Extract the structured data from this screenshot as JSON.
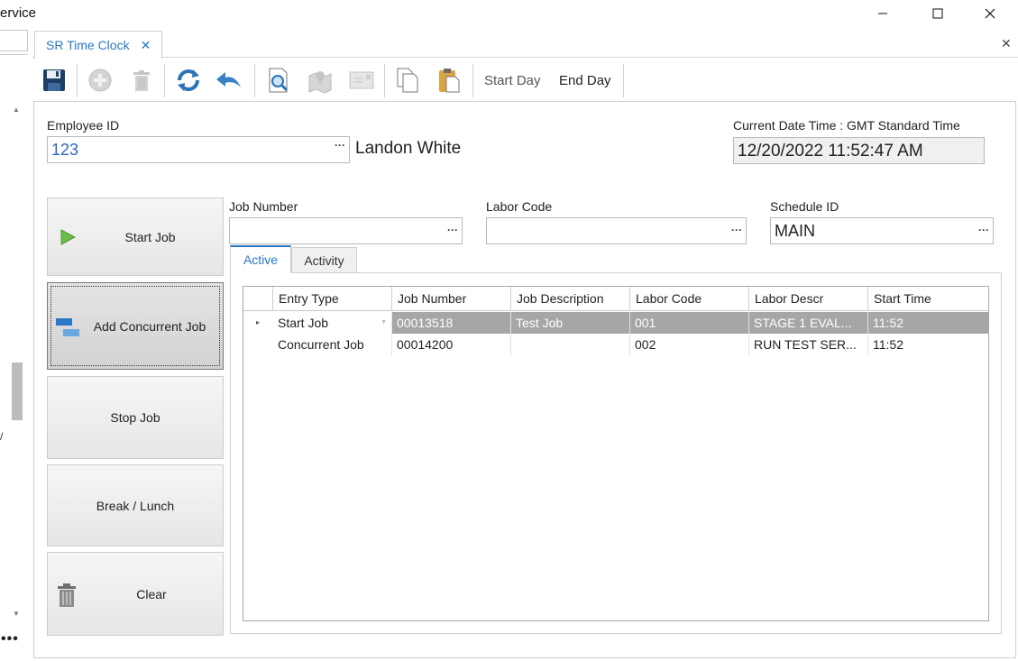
{
  "window": {
    "title": "ervice",
    "minimize_icon": "minimize-icon",
    "maximize_icon": "maximize-icon",
    "close_icon": "close-icon"
  },
  "left_pane": {
    "overflow_label": "•••",
    "edge_char": "/"
  },
  "doc_tab": {
    "label": "SR Time Clock",
    "close_glyph": "✕",
    "panel_close_glyph": "✕"
  },
  "toolbar": {
    "icons": [
      "save-icon",
      "add-icon",
      "delete-icon",
      "refresh-icon",
      "undo-icon",
      "preview-icon",
      "map-icon",
      "email-icon",
      "copy-icon",
      "paste-icon"
    ],
    "start_day": "Start Day",
    "end_day": "End Day"
  },
  "employee": {
    "label": "Employee ID",
    "value": "123",
    "name": "Landon White"
  },
  "datetime": {
    "label": "Current Date Time : GMT Standard Time",
    "value": "12/20/2022 11:52:47 AM"
  },
  "fields": {
    "job_number_label": "Job Number",
    "job_number_value": "",
    "labor_code_label": "Labor Code",
    "labor_code_value": "",
    "schedule_id_label": "Schedule ID",
    "schedule_id_value": "MAIN",
    "ellipsis": "···"
  },
  "side_buttons": {
    "start_job": "Start Job",
    "add_concurrent_job": "Add Concurrent Job",
    "stop_job": "Stop Job",
    "break_lunch": "Break / Lunch",
    "clear": "Clear"
  },
  "tabs": {
    "active": "Active",
    "activity": "Activity"
  },
  "grid": {
    "columns": [
      "Entry Type",
      "Job Number",
      "Job Description",
      "Labor Code",
      "Labor Descr",
      "Start Time"
    ],
    "rows": [
      {
        "entry_type": "Start Job",
        "job_number": "00013518",
        "job_description": "Test Job",
        "labor_code": "001",
        "labor_descr": "STAGE 1 EVAL...",
        "start_time": "11:52"
      },
      {
        "entry_type": "Concurrent Job",
        "job_number": "00014200",
        "job_description": "",
        "labor_code": "002",
        "labor_descr": "RUN TEST SER...",
        "start_time": "11:52"
      }
    ],
    "row_indicator": "▸",
    "combo_arrow": "▼"
  },
  "colors": {
    "accent": "#2b78c4",
    "selected_row": "#a6a6a6"
  }
}
